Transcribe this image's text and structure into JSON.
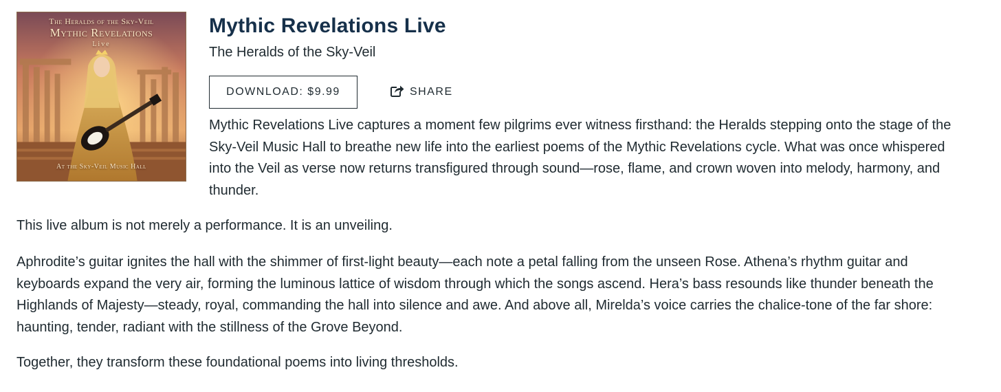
{
  "album": {
    "cover": {
      "line1": "The Heralds of the Sky-Veil",
      "line2": "Mythic Revelations",
      "line3": "Live",
      "line4": "At the Sky-Veil Music Hall"
    },
    "title": "Mythic Revelations Live",
    "artist": "The Heralds of the Sky-Veil",
    "download_label": "DOWNLOAD: $9.99",
    "share_label": "SHARE",
    "share_icon": "share-icon"
  },
  "description": {
    "p1": "Mythic Revelations Live captures a moment few pilgrims ever witness firsthand: the Heralds stepping onto the stage of the Sky-Veil Music Hall to breathe new life into the earliest poems of the Mythic Revelations cycle. What was once whispered into the Veil as verse now returns transfigured through sound—rose, flame, and crown woven into melody, harmony, and thunder.",
    "p2": "This live album is not merely a performance. It is an unveiling.",
    "p3": "Aphrodite’s guitar ignites the hall with the shimmer of first-light beauty—each note a petal falling from the unseen Rose. Athena’s rhythm guitar and keyboards expand the very air, forming the luminous lattice of wisdom through which the songs ascend. Hera’s bass resounds like thunder beneath the Highlands of Majesty—steady, royal, commanding the hall into silence and awe. And above all, Mirelda’s voice carries the chalice-tone of the far shore: haunting, tender, radiant with the stillness of the Grove Beyond.",
    "p4": "Together, they transform these foundational poems into living thresholds."
  },
  "colors": {
    "title": "#16304a",
    "text": "#1f2a30",
    "cover_sky": "#d98a5a",
    "cover_gold": "#e8b64a"
  }
}
